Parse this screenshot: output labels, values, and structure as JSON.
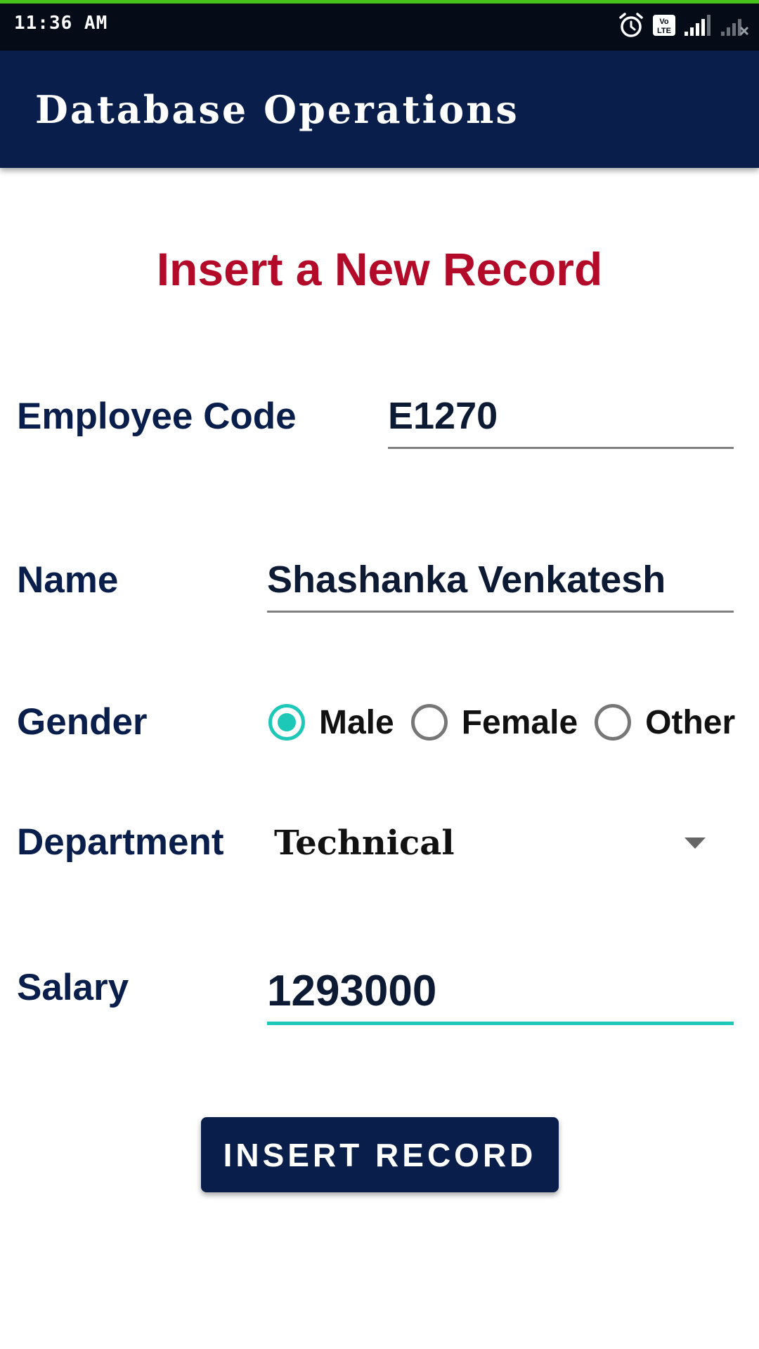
{
  "status_bar": {
    "time": "11:36 AM"
  },
  "app_bar": {
    "title": "Database Operations"
  },
  "form": {
    "heading": "Insert a New Record",
    "employee_code": {
      "label": "Employee Code",
      "value": "E1270"
    },
    "name": {
      "label": "Name",
      "value": "Shashanka Venkatesh"
    },
    "gender": {
      "label": "Gender",
      "options": [
        "Male",
        "Female",
        "Other"
      ],
      "selected": "Male"
    },
    "department": {
      "label": "Department",
      "selected": "Technical"
    },
    "salary": {
      "label": "Salary",
      "value": "1293000"
    },
    "submit_label": "INSERT RECORD"
  },
  "colors": {
    "app_bar": "#0a1e4b",
    "heading": "#b30a2a",
    "accent": "#1ec8b8",
    "status_bar": "#050b17",
    "progress_line": "#46c21a"
  },
  "icons": [
    "alarm-icon",
    "volte-icon",
    "signal-icon",
    "no-signal-icon",
    "dropdown-arrow-icon"
  ]
}
